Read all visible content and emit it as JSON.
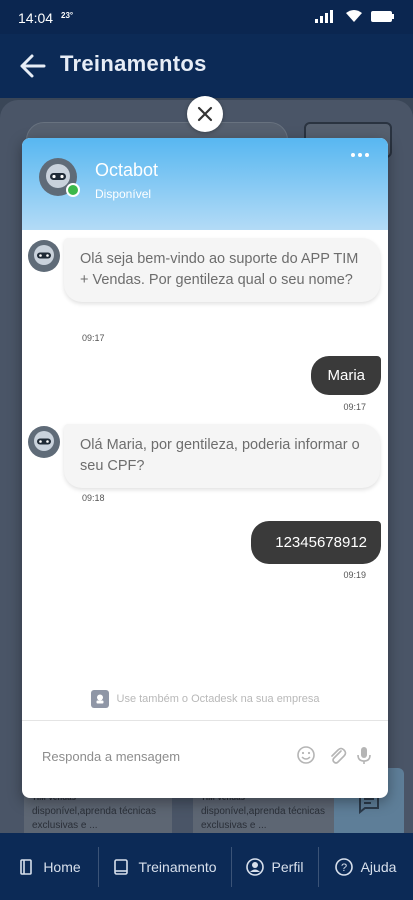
{
  "status_bar": {
    "time": "14:04",
    "temperature": "23°"
  },
  "header": {
    "title": "Treinamentos"
  },
  "background": {
    "tiles": [
      {
        "title": "TIM Vendas",
        "text": "disponível,aprenda técnicas exclusivas e ..."
      },
      {
        "title": "TIM Vendas",
        "text": "disponível,aprenda técnicas exclusivas e ..."
      }
    ]
  },
  "chat": {
    "bot_name": "Octabot",
    "bot_status": "Disponível",
    "messages": [
      {
        "from": "bot",
        "text": "Olá seja bem-vindo ao suporte do APP TIM + Vendas. Por gentileza qual o seu nome?",
        "time": "09:17"
      },
      {
        "from": "user",
        "text": "Maria",
        "time": "09:17"
      },
      {
        "from": "bot",
        "text": "Olá Maria, por gentileza, poderia informar o seu CPF?",
        "time": "09:18"
      },
      {
        "from": "user",
        "text": "12345678912",
        "time": "09:19"
      }
    ],
    "footer_note": "Use também o Octadesk na sua empresa",
    "composer_placeholder": "Responda a mensagem"
  },
  "bottom_nav": [
    {
      "label": "Home",
      "icon": "home-icon"
    },
    {
      "label": "Treinamento",
      "icon": "book-icon"
    },
    {
      "label": "Perfil",
      "icon": "user-icon"
    },
    {
      "label": "Ajuda",
      "icon": "help-icon"
    }
  ],
  "colors": {
    "header_bg": "#0c2a56",
    "chat_header_top": "#57b7f1",
    "online": "#3bb84b",
    "user_bubble": "#3a3a3a"
  }
}
